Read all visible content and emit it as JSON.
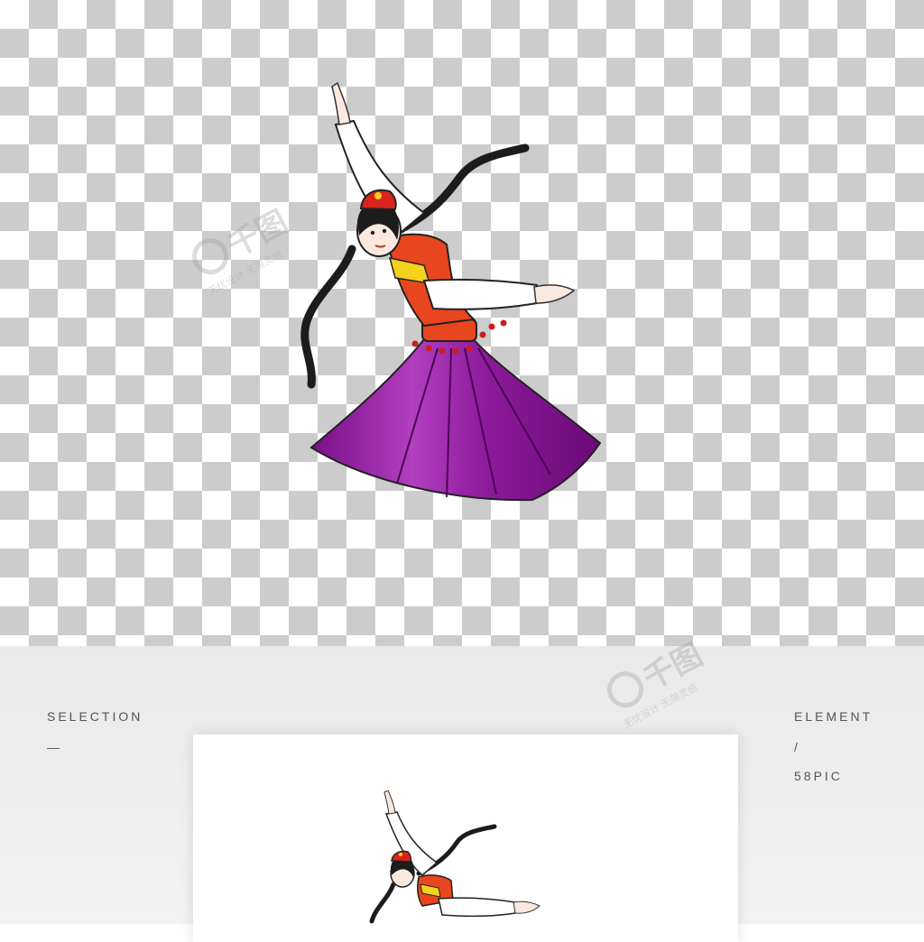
{
  "left_panel": {
    "title": "SELECTION",
    "dash": "—"
  },
  "right_panel": {
    "title": "ELEMENT",
    "slash": "/",
    "brand": "58PIC"
  },
  "watermark": {
    "logo_text": "千图",
    "tagline": "无忧设计 无限灵感"
  },
  "colors": {
    "checker_dark": "#cccccc",
    "checker_light": "#ffffff",
    "skirt": "#9a1ea6",
    "vest": "#e8461e",
    "sleeve": "#ffffff"
  }
}
